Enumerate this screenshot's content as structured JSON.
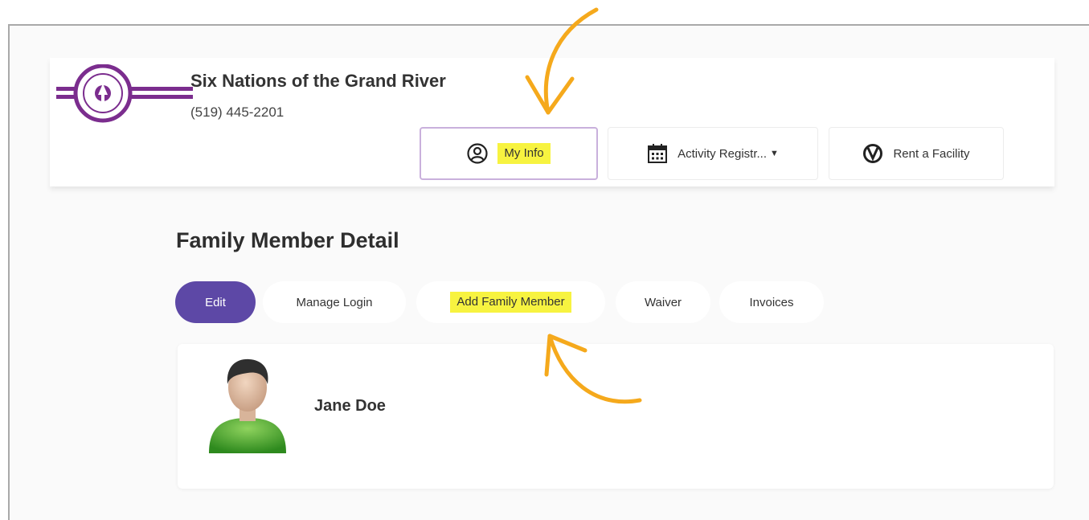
{
  "org": {
    "name": "Six Nations of the Grand River",
    "phone": "(519) 445-2201"
  },
  "nav": {
    "my_info": "My Info",
    "activity_registration": "Activity Registr...",
    "rent_facility": "Rent a Facility"
  },
  "page": {
    "title": "Family Member Detail"
  },
  "tabs": [
    {
      "label": "Edit"
    },
    {
      "label": "Manage Login"
    },
    {
      "label": "Add Family Member"
    },
    {
      "label": "Waiver"
    },
    {
      "label": "Invoices"
    }
  ],
  "member": {
    "name": "Jane Doe"
  },
  "colors": {
    "brand_purple": "#5d48a6",
    "logo_purple": "#7b2d8e",
    "highlight_yellow": "#f7f340",
    "annotation_orange": "#f5a91c"
  },
  "icons": {
    "my_info": "user-circle-icon",
    "activity_registration": "calendar-icon",
    "rent_facility": "facility-icon",
    "dropdown": "caret-down-icon"
  }
}
